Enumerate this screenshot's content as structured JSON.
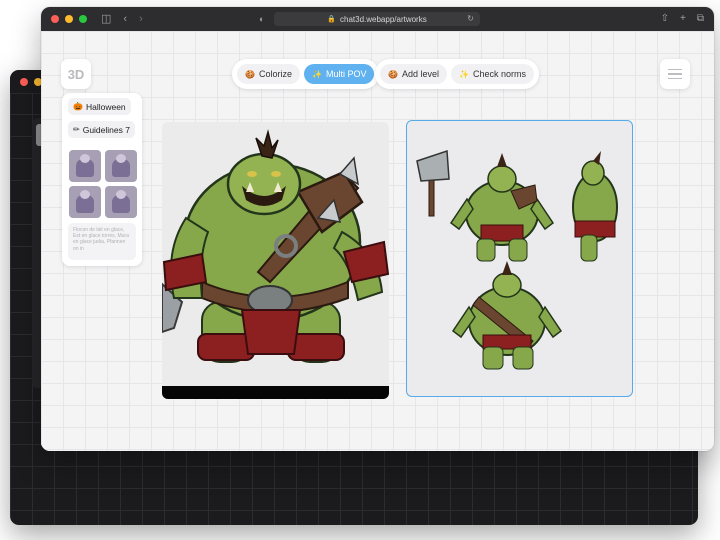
{
  "browser": {
    "url": "chat3d.webapp/artworks"
  },
  "app": {
    "logo_text": "3D"
  },
  "toolbar": {
    "group1": [
      {
        "label": "Colorize",
        "icon": "pie-icon",
        "active": false
      },
      {
        "label": "Multi POV",
        "icon": "sparkle-icon",
        "active": true
      }
    ],
    "group2": [
      {
        "label": "Add level",
        "icon": "pie-icon",
        "active": false
      },
      {
        "label": "Check norms",
        "icon": "sparkle-icon",
        "active": false
      }
    ]
  },
  "sidebar": {
    "theme_chip": "Halloween",
    "guidelines_chip": "Guidelines 7",
    "note_text": "Flocon de lait en glace, Est en glace torres, Mura en glace judia, Pfannen on in"
  },
  "colors": {
    "accent": "#5fb2ef",
    "selection_border": "#57aaea",
    "orc_skin": "#86a84b",
    "leather": "#6a4530",
    "cloth_red": "#8c1f1f"
  }
}
